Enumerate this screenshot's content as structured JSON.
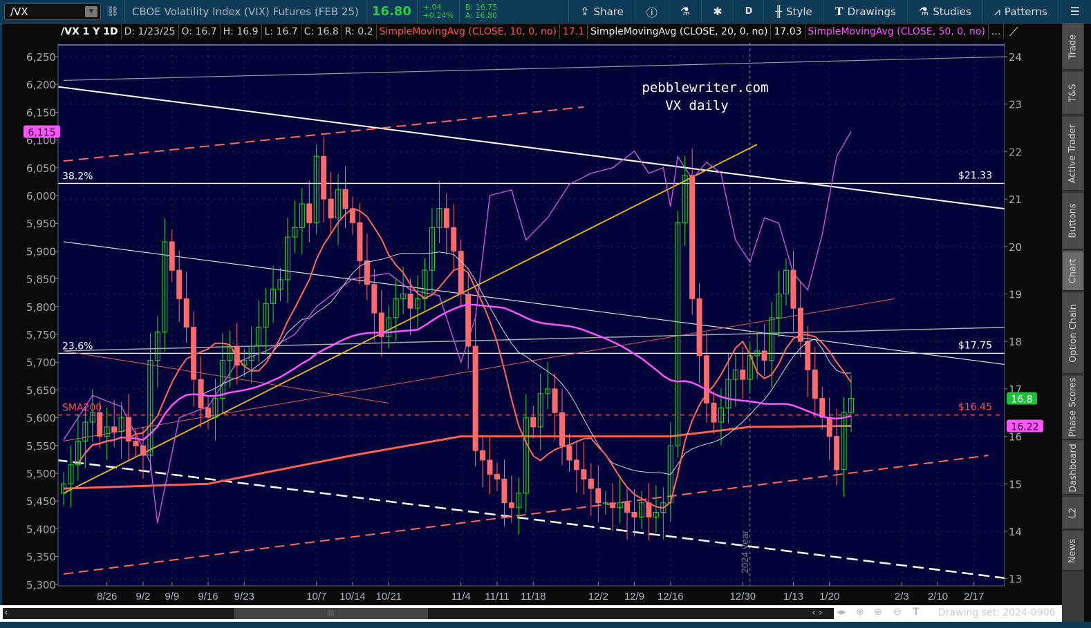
{
  "toolbar": {
    "symbol": "/VX",
    "description": "CBOE Volatility Index (VIX) Futures (FEB 25)",
    "last": "16.80",
    "change": "+.04",
    "change_pct": "+0.24%",
    "bid": "B: 16.75",
    "ask": "A: 16.80",
    "buttons": [
      "Share",
      "",
      "",
      "",
      "D",
      "Style",
      "Drawings",
      "Studies",
      "Patterns",
      ""
    ]
  },
  "legend": {
    "title": "/VX 1 Y 1D",
    "date": "D: 1/23/25",
    "open": "O: 16.7",
    "high": "H: 16.9",
    "low": "L: 16.7",
    "close": "C: 16.8",
    "range": "R: 0.2",
    "sma10": "SimpleMovingAvg (CLOSE, 10, 0, no)",
    "sma10_val": "17.1",
    "sma20": "SimpleMovingAvg (CLOSE, 20, 0, no)",
    "sma20_val": "17.03",
    "sma50": "SimpleMovingAvg (CLOSE, 50, 0, no)",
    "more": "..."
  },
  "sidebar": {
    "tabs": [
      "Trade",
      "T&S",
      "Active Trader",
      "Buttons",
      "Chart",
      "Option Chain",
      "Phase Scores",
      "Dashboard",
      "L2",
      "News"
    ],
    "active": "Chart"
  },
  "scrollbar": {
    "drawing_set": "Drawing set: 2024-0906"
  },
  "chart_data": {
    "type": "candlestick",
    "title": "pebblewriter.com",
    "subtitle": "VX daily",
    "year_marker": "2024 year",
    "year_marker_index": 95,
    "right_axis": {
      "ticks": [
        13,
        14,
        15,
        16,
        17,
        18,
        19,
        20,
        21,
        22,
        23,
        24
      ],
      "range": [
        13,
        24
      ]
    },
    "left_axis": {
      "ticks": [
        "5,300",
        "5,350",
        "5,400",
        "5,450",
        "5,500",
        "5,550",
        "5,600",
        "5,650",
        "5,700",
        "5,750",
        "5,800",
        "5,850",
        "5,900",
        "5,950",
        "6,000",
        "6,050",
        "6,100",
        "6,150",
        "6,200",
        "6,250"
      ],
      "range": [
        5300,
        6250
      ]
    },
    "x_ticks": [
      {
        "label": "8/26",
        "i": 6
      },
      {
        "label": "9/2",
        "i": 11
      },
      {
        "label": "9/9",
        "i": 15
      },
      {
        "label": "9/16",
        "i": 20
      },
      {
        "label": "9/23",
        "i": 25
      },
      {
        "label": "10/7",
        "i": 35
      },
      {
        "label": "10/14",
        "i": 40
      },
      {
        "label": "10/21",
        "i": 45
      },
      {
        "label": "11/4",
        "i": 55
      },
      {
        "label": "11/11",
        "i": 60
      },
      {
        "label": "11/18",
        "i": 65
      },
      {
        "label": "12/2",
        "i": 74
      },
      {
        "label": "12/9",
        "i": 79
      },
      {
        "label": "12/16",
        "i": 84
      },
      {
        "label": "12/30",
        "i": 94
      },
      {
        "label": "1/13",
        "i": 101
      },
      {
        "label": "1/20",
        "i": 106
      },
      {
        "label": "2/3",
        "i": 116
      },
      {
        "label": "2/10",
        "i": 121
      },
      {
        "label": "2/17",
        "i": 126
      }
    ],
    "closes": [
      15.0,
      15.4,
      15.9,
      16.3,
      16.5,
      16.0,
      16.2,
      16.1,
      16.4,
      15.9,
      15.8,
      15.6,
      17.6,
      18.2,
      20.1,
      19.5,
      18.9,
      18.3,
      17.2,
      16.6,
      16.4,
      16.8,
      17.6,
      17.9,
      17.5,
      17.6,
      17.9,
      18.3,
      18.8,
      19.1,
      19.3,
      20.2,
      20.4,
      20.9,
      20.5,
      21.9,
      21.0,
      20.6,
      21.2,
      20.8,
      20.5,
      19.7,
      19.2,
      18.6,
      18.1,
      18.5,
      18.9,
      19.0,
      18.7,
      18.9,
      19.5,
      20.4,
      20.8,
      20.4,
      19.9,
      19.0,
      17.9,
      15.7,
      15.5,
      15.2,
      15.1,
      14.6,
      14.5,
      14.8,
      16.4,
      16.2,
      16.9,
      17.0,
      16.5,
      15.8,
      15.5,
      15.3,
      15.1,
      14.9,
      14.6,
      14.6,
      14.5,
      14.6,
      14.4,
      14.3,
      14.6,
      14.3,
      14.4,
      14.6,
      15.8,
      20.5,
      21.5,
      18.9,
      17.7,
      16.7,
      16.3,
      16.6,
      17.2,
      17.4,
      17.2,
      17.7,
      17.8,
      17.6,
      18.5,
      19.0,
      19.5,
      18.7,
      18.0,
      17.4,
      16.8,
      16.4,
      16.0,
      15.3,
      16.5,
      16.8
    ],
    "sma200": [
      [
        0,
        14.9
      ],
      [
        20,
        15.0
      ],
      [
        40,
        15.6
      ],
      [
        55,
        16.0
      ],
      [
        84,
        16.0
      ],
      [
        95,
        16.2
      ],
      [
        109,
        16.22
      ]
    ],
    "spx_line": [
      [
        0,
        5560
      ],
      [
        4,
        5640
      ],
      [
        8,
        5620
      ],
      [
        12,
        5520
      ],
      [
        13,
        5410
      ],
      [
        16,
        5600
      ],
      [
        20,
        5620
      ],
      [
        24,
        5700
      ],
      [
        28,
        5720
      ],
      [
        32,
        5750
      ],
      [
        35,
        5800
      ],
      [
        40,
        5850
      ],
      [
        45,
        5860
      ],
      [
        48,
        5830
      ],
      [
        52,
        5820
      ],
      [
        55,
        5700
      ],
      [
        57,
        5780
      ],
      [
        59,
        6000
      ],
      [
        62,
        6010
      ],
      [
        64,
        5920
      ],
      [
        67,
        5960
      ],
      [
        70,
        6020
      ],
      [
        73,
        6040
      ],
      [
        76,
        6050
      ],
      [
        79,
        6080
      ],
      [
        81,
        6040
      ],
      [
        83,
        6050
      ],
      [
        84,
        5980
      ],
      [
        85,
        6070
      ],
      [
        87,
        6030
      ],
      [
        89,
        6060
      ],
      [
        91,
        6040
      ],
      [
        93,
        5920
      ],
      [
        95,
        5880
      ],
      [
        97,
        5960
      ],
      [
        99,
        5950
      ],
      [
        101,
        5860
      ],
      [
        103,
        5830
      ],
      [
        105,
        5930
      ],
      [
        107,
        6070
      ],
      [
        109,
        6115
      ]
    ],
    "trendlines": [
      {
        "p": [
          [
            -1,
            23.37
          ],
          [
            131,
            20.78
          ]
        ],
        "color": "#ffffff",
        "w": 2,
        "dash": ""
      },
      {
        "p": [
          [
            -1,
            15.5
          ],
          [
            131,
            13.0
          ]
        ],
        "color": "#ffffff",
        "w": 2.5,
        "dash": "16 8"
      },
      {
        "p": [
          [
            0,
            21.8
          ],
          [
            72,
            22.94
          ]
        ],
        "color": "#ff6a5a",
        "w": 2,
        "dash": "14 8"
      },
      {
        "p": [
          [
            0,
            13.1
          ],
          [
            128,
            15.6
          ]
        ],
        "color": "#ff6a5a",
        "w": 2,
        "dash": "14 8"
      },
      {
        "p": [
          [
            0,
            14.8
          ],
          [
            96,
            22.15
          ]
        ],
        "color": "#f2c200",
        "w": 1.8,
        "dash": ""
      },
      {
        "p": [
          [
            0,
            23.5
          ],
          [
            131,
            24.0
          ]
        ],
        "color": "#999999",
        "w": 1.2,
        "dash": ""
      },
      {
        "p": [
          [
            0,
            17.8
          ],
          [
            131,
            18.3
          ]
        ],
        "color": "#aaaaaa",
        "w": 1.5,
        "dash": ""
      },
      {
        "p": [
          [
            0,
            20.1
          ],
          [
            131,
            17.5
          ]
        ],
        "color": "#dddddd",
        "w": 1.2,
        "dash": ""
      },
      {
        "p": [
          [
            0,
            15.9
          ],
          [
            115,
            18.9
          ]
        ],
        "color": "#e0604f",
        "w": 1,
        "dash": ""
      },
      {
        "p": [
          [
            0,
            17.8
          ],
          [
            45,
            16.7
          ]
        ],
        "color": "#e0604f",
        "w": 1,
        "dash": ""
      }
    ],
    "levels": [
      {
        "value": 21.33,
        "left_label": "38.2%",
        "right_label": "$21.33",
        "color": "#ffffff",
        "dash": ""
      },
      {
        "value": 17.75,
        "left_label": "23.6%",
        "right_label": "$17.75",
        "color": "#ffffff",
        "dash": ""
      },
      {
        "value": 16.45,
        "left_label": "SMA200",
        "right_label": "$16.45",
        "color": "#ff5050",
        "dash": "6 6"
      }
    ],
    "markers": [
      {
        "axis": "right",
        "value": 16.8,
        "label": "16.8",
        "color": "#1fbf3a",
        "text": "#ffffff"
      },
      {
        "axis": "right",
        "value": 16.22,
        "label": "16.22",
        "color": "#ff55ff",
        "text": "#220022"
      },
      {
        "axis": "left",
        "value": 6115,
        "label": "6,115",
        "color": "#ff55ff",
        "text": "#220022"
      }
    ],
    "colors": {
      "up": "#22dd22",
      "down": "#ff6b6b",
      "sma10": "#ff6b5b",
      "sma20": "#d8d8d8",
      "sma50": "#ff55ff",
      "sma200": "#ff5f4f",
      "spx": "#cc55dd",
      "bg": "#03033a"
    }
  }
}
